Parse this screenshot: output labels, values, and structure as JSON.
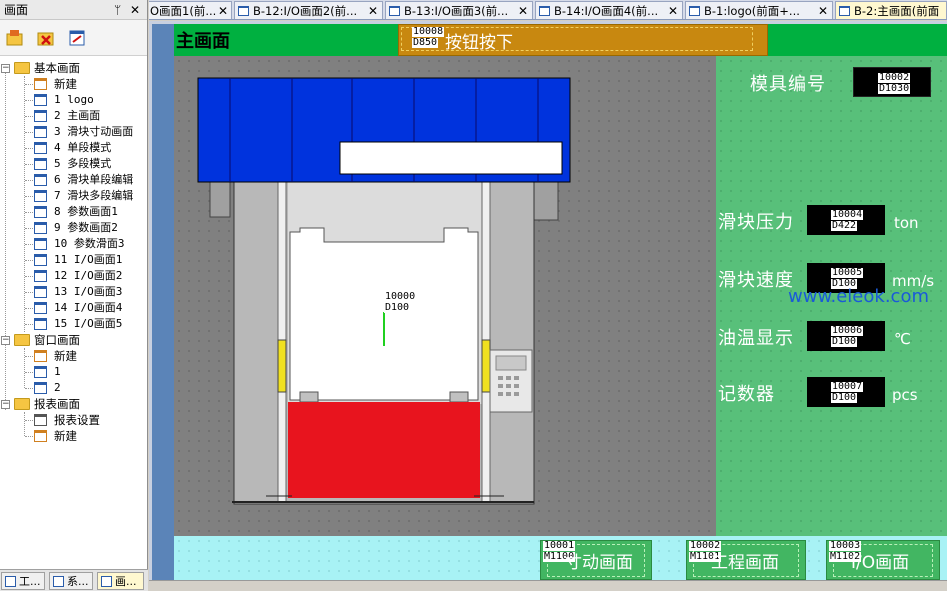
{
  "left_panel": {
    "title": "画面",
    "pin": "ᛘ",
    "close": "✕",
    "tree": {
      "basic": {
        "label": "基本画面",
        "new": "新建",
        "items": [
          "1 logo",
          "2 主画面",
          "3 滑块寸动画面",
          "4 单段模式",
          "5 多段模式",
          "6 滑块单段编辑",
          "7 滑块多段编辑",
          "8 参数画面1",
          "9 参数画面2",
          "10 参数滑面3",
          "11 I/O画面1",
          "12 I/O画面2",
          "13 I/O画面3",
          "14 I/O画面4",
          "15 I/O画面5"
        ]
      },
      "window": {
        "label": "窗口画面",
        "new": "新建",
        "items": [
          "1",
          "2"
        ]
      },
      "report": {
        "label": "报表画面",
        "items": [
          "报表设置",
          "新建"
        ]
      }
    },
    "tabs": [
      "工...",
      "系...",
      "画..."
    ]
  },
  "doc_tabs": [
    {
      "label": "O画面1(前...",
      "close": "✕"
    },
    {
      "label": "B-12:I/O画面2(前...",
      "close": "✕"
    },
    {
      "label": "B-13:I/O画面3(前...",
      "close": "✕"
    },
    {
      "label": "B-14:I/O画面4(前...",
      "close": "✕"
    },
    {
      "label": "B-1:logo(前面+...",
      "close": "✕"
    },
    {
      "label": "B-2:主画面(前面",
      "close": ""
    }
  ],
  "screen": {
    "title": "主画面",
    "alarm": {
      "tag1": "10008",
      "tag2": "D850",
      "text": "按钮按下"
    },
    "mold_label": "模具编号",
    "mold_box": {
      "a": "10002",
      "b": "D1030"
    },
    "center_tag": {
      "a": "10000",
      "b": "D100"
    },
    "readouts": [
      {
        "label": "滑块压力",
        "a": "10004",
        "b": "D422",
        "unit": "ton"
      },
      {
        "label": "滑块速度",
        "a": "10005",
        "b": "D100",
        "unit": "mm/s"
      },
      {
        "label": "油温显示",
        "a": "10006",
        "b": "D100",
        "unit": "℃"
      },
      {
        "label": "记数器",
        "a": "10007",
        "b": "D100",
        "unit": "pcs"
      }
    ],
    "watermark": "www.eleok.com",
    "buttons": [
      {
        "tag1": "10001",
        "tag2": "M1100",
        "label": "寸动画面"
      },
      {
        "tag1": "10002",
        "tag2": "M1101",
        "label": "工程画面"
      },
      {
        "tag1": "10003",
        "tag2": "M1102",
        "label": "I/O画面"
      }
    ]
  },
  "colors": {
    "accent_green": "#00b040",
    "panel_green": "#58c07a",
    "press_blue": "#0033dd",
    "press_red": "#e8141e",
    "cyan": "#a8f2f5"
  }
}
